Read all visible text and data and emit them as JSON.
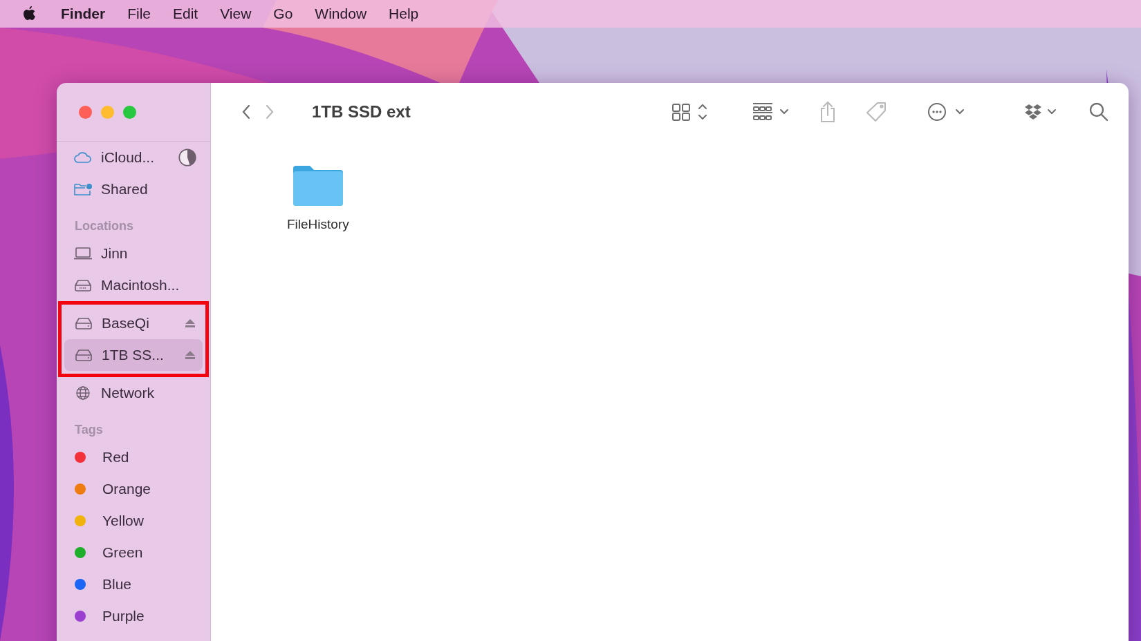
{
  "menu_bar": {
    "app_name": "Finder",
    "menus": [
      "File",
      "Edit",
      "View",
      "Go",
      "Window",
      "Help"
    ]
  },
  "window": {
    "title": "1TB SSD ext",
    "toolbar": [
      {
        "kind": "back",
        "disabled": false
      },
      {
        "kind": "forward",
        "disabled": true
      },
      {
        "kind": "view",
        "disabled": false
      },
      {
        "kind": "group",
        "disabled": false
      },
      {
        "kind": "share",
        "disabled": true
      },
      {
        "kind": "tag",
        "disabled": true
      },
      {
        "kind": "more",
        "disabled": false
      },
      {
        "kind": "dropbox",
        "disabled": false
      },
      {
        "kind": "search",
        "disabled": false
      }
    ],
    "sidebar": {
      "top_items": [
        {
          "label": "iCloud...",
          "kind": "cloud",
          "level": 0.45,
          "selected": false
        },
        {
          "label": "Shared",
          "kind": "shared",
          "selected": false
        }
      ],
      "locations": {
        "heading": "Locations",
        "items": [
          {
            "label": "Jinn",
            "kind": "computer",
            "ejectable": false,
            "highlighted": false,
            "selected": false
          },
          {
            "label": "Macintosh...",
            "kind": "internal-disk",
            "ejectable": false,
            "highlighted": false,
            "selected": false
          },
          {
            "label": "BaseQi",
            "kind": "disk",
            "ejectable": true,
            "highlighted": true,
            "selected": false
          },
          {
            "label": "1TB SS...",
            "kind": "disk",
            "ejectable": true,
            "highlighted": true,
            "selected": true
          },
          {
            "label": "Network",
            "kind": "network",
            "ejectable": false,
            "highlighted": false,
            "selected": false
          }
        ]
      },
      "tags": {
        "heading": "Tags",
        "items": [
          {
            "label": "Red",
            "color": "#f2313a"
          },
          {
            "label": "Orange",
            "color": "#ef7c10"
          },
          {
            "label": "Yellow",
            "color": "#f2b20c"
          },
          {
            "label": "Green",
            "color": "#1fae2c"
          },
          {
            "label": "Blue",
            "color": "#1b66f5"
          },
          {
            "label": "Purple",
            "color": "#9b3fd0"
          }
        ]
      }
    },
    "files": [
      {
        "name": "FileHistory",
        "kind": "folder"
      }
    ]
  }
}
